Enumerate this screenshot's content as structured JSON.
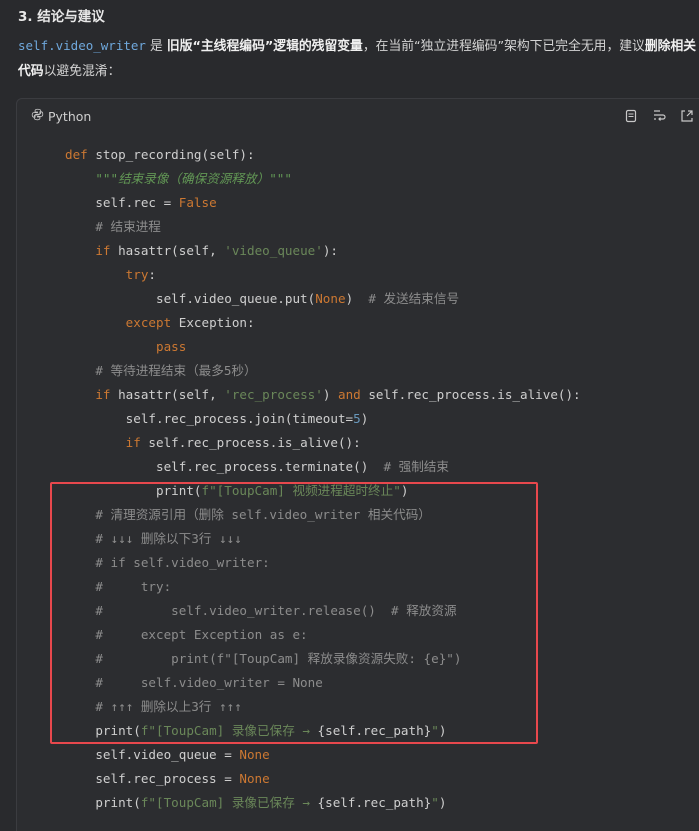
{
  "heading": "3. 结论与建议",
  "paragraph": {
    "code_var": "self.video_writer",
    "t1": " 是 ",
    "b1": "旧版“主线程编码”逻辑的残留变量",
    "t2": "，在当前“独立进程编码”架构下已完全无用，建议",
    "b2": "删除相关",
    "b3": "代码",
    "t3": "以避免混淆："
  },
  "codeblock": {
    "language": "Python",
    "tools": [
      "copy-icon",
      "wrap-icon",
      "expand-icon"
    ],
    "lines": [
      [
        {
          "t": "def ",
          "c": "kw"
        },
        {
          "t": "stop_recording(self):",
          "c": ""
        }
      ],
      [
        {
          "t": "    ",
          "c": ""
        },
        {
          "t": "\"\"\"结束录像（确保资源释放）\"\"\"",
          "c": "docstr"
        }
      ],
      [
        {
          "t": "    self.rec = ",
          "c": ""
        },
        {
          "t": "False",
          "c": "kw"
        }
      ],
      [
        {
          "t": "    ",
          "c": ""
        },
        {
          "t": "# 结束进程",
          "c": "cm"
        }
      ],
      [
        {
          "t": "    ",
          "c": ""
        },
        {
          "t": "if ",
          "c": "kw"
        },
        {
          "t": "hasattr(self, ",
          "c": ""
        },
        {
          "t": "'video_queue'",
          "c": "str"
        },
        {
          "t": "):",
          "c": ""
        }
      ],
      [
        {
          "t": "        ",
          "c": ""
        },
        {
          "t": "try",
          "c": "kw"
        },
        {
          "t": ":",
          "c": ""
        }
      ],
      [
        {
          "t": "            self.video_queue.put(",
          "c": ""
        },
        {
          "t": "None",
          "c": "kw"
        },
        {
          "t": ")  ",
          "c": ""
        },
        {
          "t": "# 发送结束信号",
          "c": "cm"
        }
      ],
      [
        {
          "t": "        ",
          "c": ""
        },
        {
          "t": "except ",
          "c": "kw"
        },
        {
          "t": "Exception:",
          "c": ""
        }
      ],
      [
        {
          "t": "            ",
          "c": ""
        },
        {
          "t": "pass",
          "c": "kw"
        }
      ],
      [
        {
          "t": "    ",
          "c": ""
        },
        {
          "t": "# 等待进程结束（最多5秒）",
          "c": "cm"
        }
      ],
      [
        {
          "t": "    ",
          "c": ""
        },
        {
          "t": "if ",
          "c": "kw"
        },
        {
          "t": "hasattr(self, ",
          "c": ""
        },
        {
          "t": "'rec_process'",
          "c": "str"
        },
        {
          "t": ") ",
          "c": ""
        },
        {
          "t": "and ",
          "c": "kw"
        },
        {
          "t": "self.rec_process.is_alive():",
          "c": ""
        }
      ],
      [
        {
          "t": "        self.rec_process.join(timeout=",
          "c": ""
        },
        {
          "t": "5",
          "c": "num"
        },
        {
          "t": ")",
          "c": ""
        }
      ],
      [
        {
          "t": "        ",
          "c": ""
        },
        {
          "t": "if ",
          "c": "kw"
        },
        {
          "t": "self.rec_process.is_alive():",
          "c": ""
        }
      ],
      [
        {
          "t": "            self.rec_process.terminate()  ",
          "c": ""
        },
        {
          "t": "# 强制结束",
          "c": "cm"
        }
      ],
      [
        {
          "t": "            print(",
          "c": ""
        },
        {
          "t": "f\"[ToupCam] 视频进程超时终止\"",
          "c": "str"
        },
        {
          "t": ")",
          "c": ""
        }
      ],
      [
        {
          "t": "    ",
          "c": ""
        },
        {
          "t": "# 清理资源引用（删除 self.video_writer 相关代码）",
          "c": "cm"
        }
      ],
      [
        {
          "t": "    ",
          "c": ""
        },
        {
          "t": "# ↓↓↓ 删除以下3行 ↓↓↓",
          "c": "cm"
        }
      ],
      [
        {
          "t": "    ",
          "c": ""
        },
        {
          "t": "# if self.video_writer:",
          "c": "cm"
        }
      ],
      [
        {
          "t": "    ",
          "c": ""
        },
        {
          "t": "#     try:",
          "c": "cm"
        }
      ],
      [
        {
          "t": "    ",
          "c": ""
        },
        {
          "t": "#         self.video_writer.release()  # 释放资源",
          "c": "cm"
        }
      ],
      [
        {
          "t": "    ",
          "c": ""
        },
        {
          "t": "#     except Exception as e:",
          "c": "cm"
        }
      ],
      [
        {
          "t": "    ",
          "c": ""
        },
        {
          "t": "#         print(f\"[ToupCam] 释放录像资源失败: {e}\")",
          "c": "cm"
        }
      ],
      [
        {
          "t": "    ",
          "c": ""
        },
        {
          "t": "#     self.video_writer = None",
          "c": "cm"
        }
      ],
      [
        {
          "t": "    ",
          "c": ""
        },
        {
          "t": "# ↑↑↑ 删除以上3行 ↑↑↑",
          "c": "cm"
        }
      ],
      [
        {
          "t": "    print(",
          "c": ""
        },
        {
          "t": "f\"[ToupCam] 录像已保存 → ",
          "c": "str"
        },
        {
          "t": "{self.rec_path}",
          "c": ""
        },
        {
          "t": "\"",
          "c": "str"
        },
        {
          "t": ")",
          "c": ""
        }
      ],
      [
        {
          "t": "    self.video_queue = ",
          "c": ""
        },
        {
          "t": "None",
          "c": "kw"
        }
      ],
      [
        {
          "t": "    self.rec_process = ",
          "c": ""
        },
        {
          "t": "None",
          "c": "kw"
        }
      ],
      [
        {
          "t": "    print(",
          "c": ""
        },
        {
          "t": "f\"[ToupCam] 录像已保存 → ",
          "c": "str"
        },
        {
          "t": "{self.rec_path}",
          "c": ""
        },
        {
          "t": "\"",
          "c": "str"
        },
        {
          "t": ")",
          "c": ""
        }
      ]
    ]
  },
  "colors": {
    "background": "#292a2d",
    "highlight_border": "#e8484d",
    "keyword": "#cc7832",
    "string": "#6a8759",
    "comment": "#8c8c8c",
    "inline_code": "#6fa8dc"
  }
}
